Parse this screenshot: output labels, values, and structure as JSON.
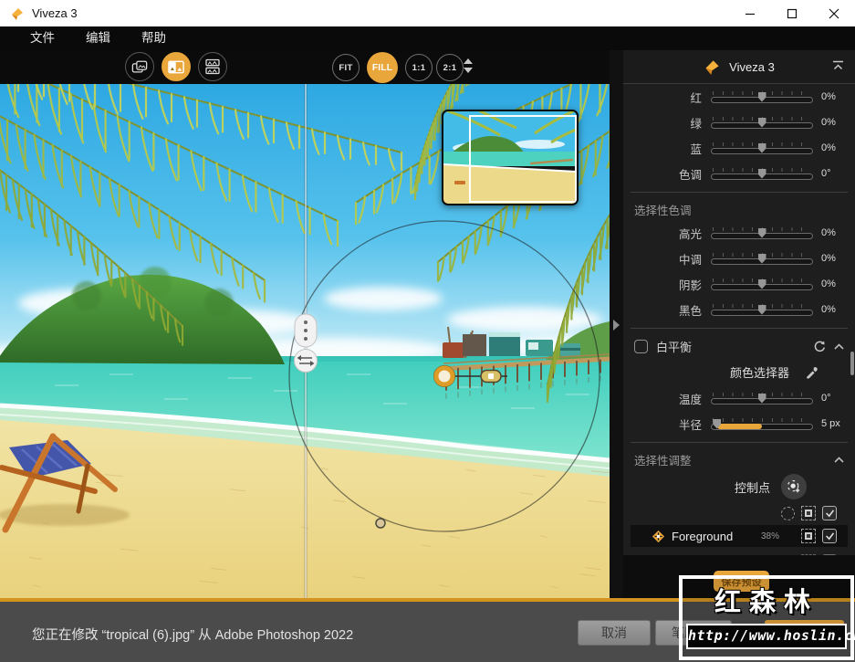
{
  "window": {
    "title": "Viveza 3",
    "controls": {
      "minimize": "minimize",
      "maximize": "maximize",
      "close": "close"
    }
  },
  "menu": {
    "items": [
      "文件",
      "编辑",
      "帮助"
    ]
  },
  "toolbar": {
    "view_modes": [
      "single-view",
      "split-view",
      "stacked-view"
    ],
    "active_view": "split-view",
    "zoom_buttons": [
      {
        "label": "FIT",
        "active": false
      },
      {
        "label": "FILL",
        "active": true
      },
      {
        "label": "1:1",
        "active": false
      },
      {
        "label": "2:1",
        "active": false
      }
    ]
  },
  "panel": {
    "header_title": "Viveza 3",
    "rgb_sliders": [
      {
        "label": "红",
        "value": "0%"
      },
      {
        "label": "绿",
        "value": "0%"
      },
      {
        "label": "蓝",
        "value": "0%"
      },
      {
        "label": "色调",
        "value": "0°"
      }
    ],
    "tones": {
      "title": "选择性色调",
      "sliders": [
        {
          "label": "高光",
          "value": "0%"
        },
        {
          "label": "中调",
          "value": "0%"
        },
        {
          "label": "阴影",
          "value": "0%"
        },
        {
          "label": "黑色",
          "value": "0%"
        }
      ]
    },
    "wb": {
      "title": "白平衡",
      "checkbox_checked": false,
      "picker_label": "颜色选择器",
      "sliders": [
        {
          "label": "温度",
          "value": "0°"
        },
        {
          "label": "半径",
          "value": "5 px"
        }
      ]
    },
    "sel": {
      "title": "选择性调整",
      "cp_label": "控制点",
      "row": {
        "name": "Foreground",
        "pct": "38%",
        "checked": true
      }
    },
    "save_preset": "保存预设"
  },
  "statusbar": {
    "message": "您正在修改 “tropical (6).jpg” 从 Adobe Photoshop 2022",
    "cancel_label": "取消",
    "brush_label": "笔刷",
    "ok_label": ""
  },
  "watermark": {
    "title": "红森林",
    "url": "http://www.hoslin.cn/"
  },
  "colors": {
    "accent": "#E9A63B",
    "panel_bg": "#1E1E1E",
    "toolbar_bg": "#0B0B0B",
    "statusbar_bg": "#4B4B4B",
    "gold_separator": "#D2941F"
  },
  "icons": {
    "app_logo": "nik-diamond",
    "panel_collapse": "collapse-up",
    "wb_reset": "reset-arrow",
    "color_picker": "eyedropper",
    "add_control_point": "crosshair-plus",
    "control_point": "orange-diamond",
    "mask": "mask-square",
    "check": "checkmark"
  }
}
